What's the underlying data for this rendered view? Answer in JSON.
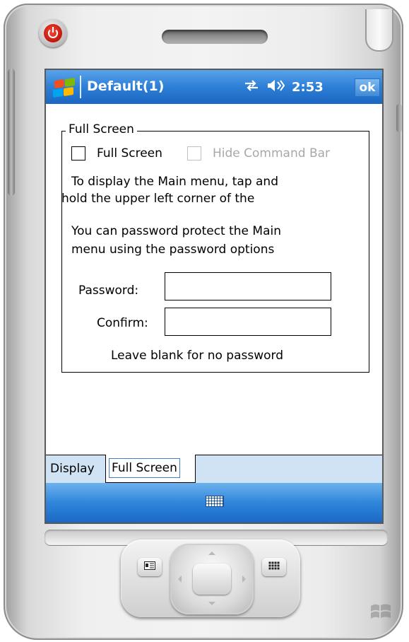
{
  "window": {
    "title": "Default(1)",
    "time": "2:53",
    "ok_label": "ok"
  },
  "group": {
    "label": "Full Screen",
    "full_screen_checkbox_label": "Full Screen",
    "hide_command_bar_label": "Hide Command Bar",
    "info_line1": "To display the Main menu, tap and",
    "info_line2": "hold the upper left corner of the",
    "info_line3": "You can password protect the Main",
    "info_line4": " menu using the password options",
    "password_label": "Password:",
    "confirm_label": "Confirm:",
    "hint": "Leave blank for no password"
  },
  "tabs": [
    {
      "label": "Display"
    },
    {
      "label": "Full Screen"
    }
  ],
  "colors": {
    "titlebar": "#2d7fd6",
    "tab_strip": "#cfe3f5",
    "power_button": "#c0160b"
  },
  "icons": [
    "power-icon",
    "windows-logo-icon",
    "connectivity-icon",
    "speaker-icon",
    "keyboard-icon",
    "contact-card-icon",
    "calendar-grid-icon"
  ]
}
